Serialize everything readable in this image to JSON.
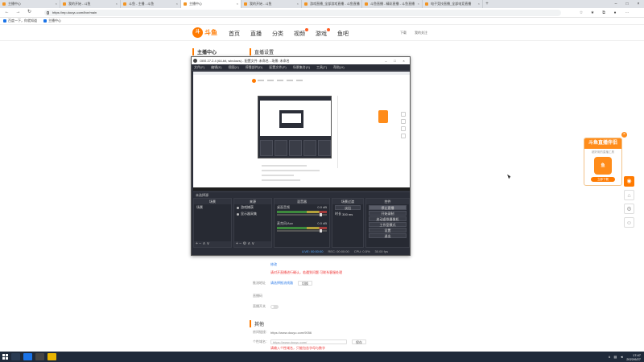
{
  "browser": {
    "tabs": [
      {
        "label": "主播中心",
        "active": false
      },
      {
        "label": "我的开始 - 斗鱼",
        "active": false
      },
      {
        "label": "斗鱼 - 主播 - 斗鱼",
        "active": false
      },
      {
        "label": "主播中心",
        "active": true
      },
      {
        "label": "我的开始 - 斗鱼",
        "active": false
      },
      {
        "label": "游戏直播_全部游戏直播 - 斗鱼直播",
        "active": false
      },
      {
        "label": "斗鱼直播 - 精彩直播 - 斗鱼直播",
        "active": false
      },
      {
        "label": "电子竞技直播_全部电竞直播",
        "active": false
      }
    ],
    "url": "https://mp.douyu.com/live/main",
    "bookmarks": [
      "百度一下，你就知道",
      "主播中心"
    ]
  },
  "site": {
    "logo_mark": "斗",
    "logo_text": "斗鱼",
    "nav": [
      "首页",
      "直播",
      "分类",
      "视频",
      "游戏",
      "鱼吧"
    ],
    "header_right": [
      "下载",
      "我的关注"
    ]
  },
  "sidebar": {
    "title": "主播中心"
  },
  "main": {
    "section_title": "直播设置",
    "rows": [
      {
        "label": "",
        "value": "修改"
      },
      {
        "label": "",
        "value": "请对开直播进行确认，若遇到问题 可联系客服处理"
      },
      {
        "label": "推流地址",
        "value": "请选择推流线路"
      },
      {
        "label": "直播码",
        "value": ""
      },
      {
        "label": "直播开关",
        "value": ""
      }
    ],
    "switch_button": "切换",
    "other_title": "其他",
    "room_label": "房间链接：",
    "room_url": "https://www.douyu.com/9056",
    "custom_label": "个性域名：",
    "custom_placeholder": "https://www.douyu.com/",
    "custom_btn": "保存",
    "custom_warn": "请输入个性域名，只能包含字母与数字"
  },
  "obs": {
    "title": "OBS 27.2.4 (64-bit, windows) - 配置文件: 未命名 - 场景: 未命名",
    "menu": [
      "文件(F)",
      "编辑(E)",
      "视图(V)",
      "停靠部件(D)",
      "配置文件(P)",
      "场景集合(S)",
      "工具(T)",
      "帮助(H)"
    ],
    "strip": "未选择源",
    "docks": {
      "scenes": {
        "title": "场景",
        "items": [
          "场景"
        ]
      },
      "sources": {
        "title": "来源",
        "items": [
          "游戏捕获",
          "显示器采集"
        ]
      },
      "mixer": {
        "title": "混音器",
        "channels": [
          {
            "name": "桌面音频",
            "level": "0.0 dB"
          },
          {
            "name": "麦克风/Aux",
            "level": "0.0 dB"
          }
        ]
      },
      "transitions": {
        "title": "场景过渡",
        "mode": "淡出",
        "duration_label": "时长",
        "duration": "300 ms"
      },
      "controls": {
        "title": "控件",
        "buttons": [
          "停止直播",
          "开始录制",
          "启动虚拟摄像机",
          "工作室模式",
          "设置",
          "退出"
        ]
      }
    },
    "status": [
      "LIVE: 00:00:00",
      "REC: 00:00:00",
      "CPU: 0.5%",
      "30.00 fps"
    ]
  },
  "ad": {
    "title": "斗鱼直播伴侣",
    "subtitle": "超好用的直播工具",
    "icon_text": "鱼",
    "button": "立即下载",
    "close": "×"
  },
  "taskbar": {
    "time": "17:47",
    "date": "2022/6/27"
  },
  "colors": {
    "brand": "#ff7a00",
    "obs_bg": "#2b2e38",
    "taskbar": "#1f2a3a"
  }
}
